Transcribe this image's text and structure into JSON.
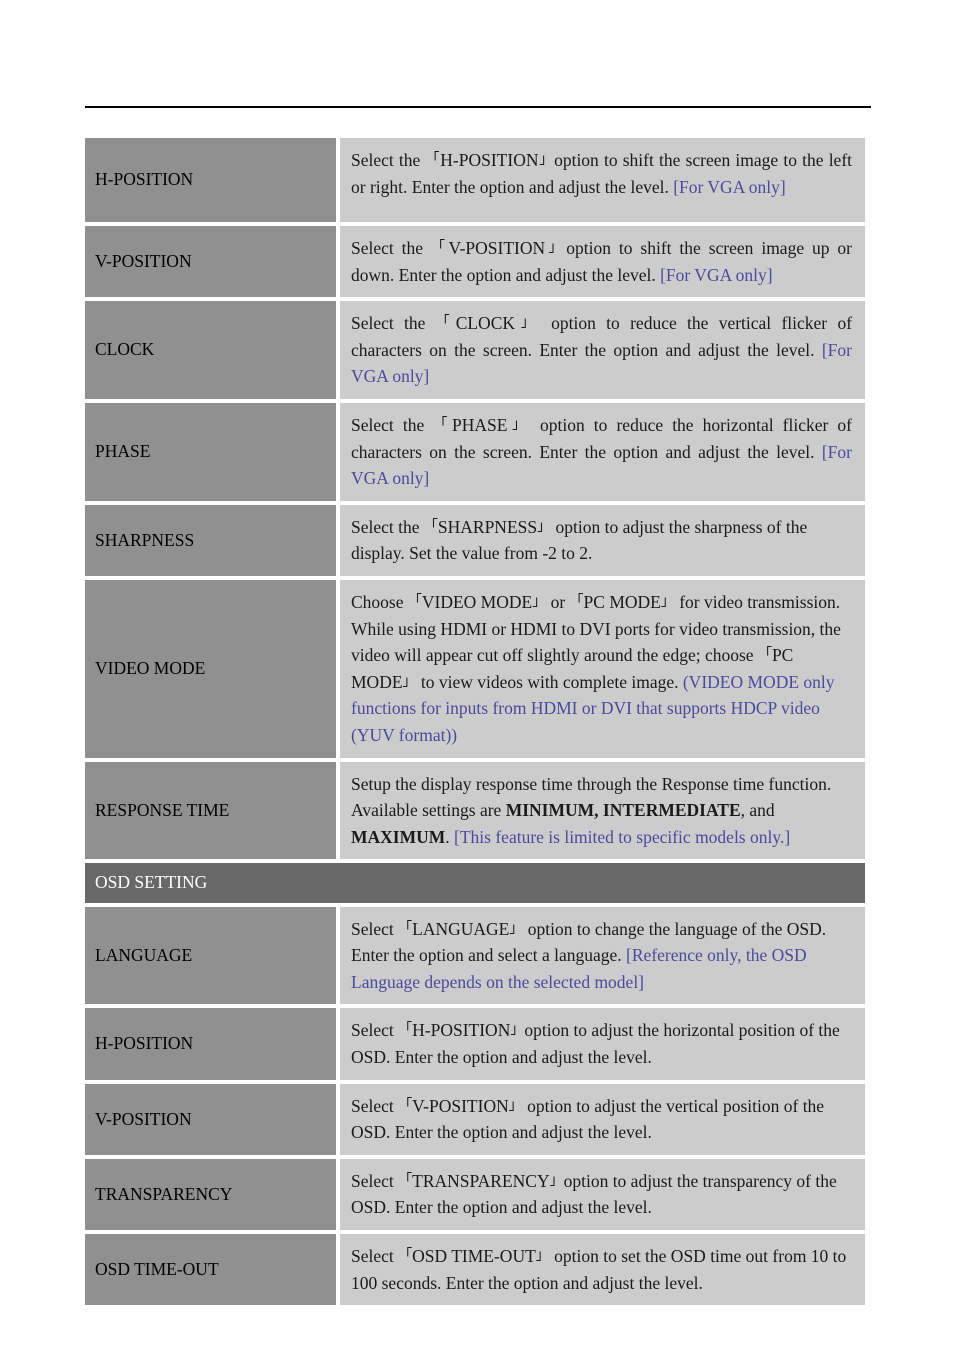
{
  "page": {
    "header_rule": true
  },
  "table": {
    "section_header": "OSD SETTING",
    "rows": [
      {
        "key": "h-position-1",
        "label": "H-POSITION",
        "desc_prefix": "Select the ",
        "open_bracket": "「",
        "term": "H-POSITION",
        "close_bracket": "」",
        "desc_body": "option to shift the screen image to the left or right. Enter the option and adjust the level. ",
        "note": "[For VGA only]"
      },
      {
        "key": "v-position-1",
        "label": "V-POSITION",
        "desc_prefix": "Select the  ",
        "open_bracket": "「",
        "term": "V-POSITION",
        "close_bracket": "」",
        "desc_body": "option to shift the screen image up or down. Enter the option and adjust the level. ",
        "note": "[For VGA only]"
      },
      {
        "key": "clock",
        "label": "CLOCK",
        "desc_prefix": "Select the  ",
        "open_bracket": "「",
        "term": "CLOCK",
        "close_bracket": "」",
        "desc_body": " option to reduce the vertical flicker of characters on the screen. Enter the option and adjust the level. ",
        "note": "[For VGA only]"
      },
      {
        "key": "phase",
        "label": "PHASE",
        "desc_prefix": "Select the ",
        "open_bracket": "「",
        "term": "PHASE",
        "close_bracket": "」",
        "desc_body": " option to reduce the horizontal flicker of characters on the screen. Enter the option and adjust the level. ",
        "note": "[For VGA only]"
      },
      {
        "key": "sharpness",
        "label": "SHARPNESS",
        "desc_prefix": "Select the ",
        "open_bracket": "「",
        "term": "SHARPNESS",
        "close_bracket": "」",
        "desc_body": " option to adjust the sharpness of the display. Set the value from -2 to 2.",
        "note": ""
      },
      {
        "key": "video-mode",
        "label": "VIDEO MODE",
        "desc_prefix": "Choose ",
        "open_bracket": "「",
        "term": "VIDEO MODE",
        "close_bracket": "」",
        "desc_body": " or  ",
        "open_bracket_2": "「",
        "term_2": "PC MODE",
        "close_bracket_2": "」",
        "desc_body_2": " for video transmission. While using HDMI or HDMI to DVI ports for video transmission, the video will appear cut off slightly around the edge; choose ",
        "open_bracket_3": "「",
        "term_3": "PC MODE",
        "close_bracket_3": "」",
        "desc_body_3": " to view videos with complete image. ",
        "note": "(VIDEO MODE only functions for inputs from HDMI or DVI that supports HDCP video (YUV format))"
      },
      {
        "key": "response-time",
        "label": "RESPONSE TIME",
        "desc_prefix": "Setup the display response time through the Response time function. Available settings are ",
        "bold_1": "MINIMUM, INTERMEDIATE",
        "desc_body": ", and ",
        "bold_2": "MAXIMUM",
        "desc_body_2": ". ",
        "note": "[This feature is limited to specific models only.]"
      },
      {
        "key": "language",
        "label": "LANGUAGE",
        "desc_prefix": "Select  ",
        "open_bracket": "「",
        "term": "LANGUAGE",
        "close_bracket": "」",
        "desc_body": "  option to change the language of the OSD. Enter the option and select a language. ",
        "note": "[Reference only, the OSD Language depends on the selected model]"
      },
      {
        "key": "h-position-2",
        "label": "H-POSITION",
        "desc_prefix": "Select ",
        "open_bracket": "「",
        "term": "H-POSITION",
        "close_bracket": "」",
        "desc_body": "option to adjust the horizontal position of the OSD. Enter the option and adjust the level.",
        "note": ""
      },
      {
        "key": "v-position-2",
        "label": "V-POSITION",
        "desc_prefix": "Select  ",
        "open_bracket": "「",
        "term": "V-POSITION",
        "close_bracket": "」",
        "desc_body": " option to adjust the vertical position of the OSD. Enter the option and adjust the level.",
        "note": ""
      },
      {
        "key": "transparency",
        "label": "TRANSPARENCY",
        "desc_prefix": "Select ",
        "open_bracket": "「",
        "term": "TRANSPARENCY",
        "close_bracket": "」",
        "desc_body": "option to adjust the transparency of the OSD. Enter the option and adjust the level.",
        "note": ""
      },
      {
        "key": "osd-time-out",
        "label": "OSD TIME-OUT",
        "desc_prefix": "Select  ",
        "open_bracket": "「",
        "term": "OSD TIME-OUT",
        "close_bracket": "」",
        "desc_body": " option to set the OSD time out from 10 to 100 seconds. Enter the option and adjust the level.",
        "note": ""
      }
    ]
  },
  "colors": {
    "label_bg": "#909090",
    "desc_bg": "#cccccc",
    "section_bg": "#686868",
    "note_text": "#4a4a9c",
    "body_text": "#1a1a1a",
    "page_bg": "#ffffff"
  }
}
